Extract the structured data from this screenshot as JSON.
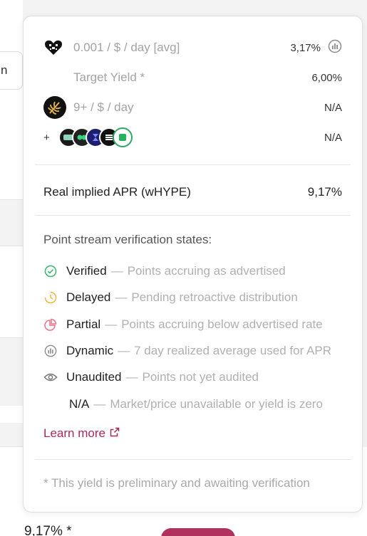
{
  "background": {
    "left_button_text": "n",
    "bottom_value": "9,17% *"
  },
  "tooltip": {
    "rows": [
      {
        "label": "0.001 / $ / day [avg]",
        "value": "3,17%",
        "icon": "hype-logo-icon",
        "status_icon": "dynamic-chart-icon"
      },
      {
        "label": "Target Yield *",
        "value": "6,00%"
      },
      {
        "label": "9+ / $ / day",
        "value": "N/A",
        "icon": "gold-leaf-logo-icon"
      },
      {
        "prefix": "+",
        "value": "N/A",
        "icons": [
          "coin-icon-1",
          "coin-icon-2",
          "coin-icon-3",
          "coin-icon-4",
          "coin-icon-5"
        ]
      }
    ],
    "apr": {
      "label": "Real implied APR (wHYPE)",
      "value": "9,17%"
    },
    "states_title": "Point stream verification states:",
    "states": [
      {
        "name": "Verified",
        "desc": "Points accruing as advertised",
        "icon": "check-circle-icon",
        "color": "#3bb56b"
      },
      {
        "name": "Delayed",
        "desc": "Pending retroactive distribution",
        "icon": "clock-icon",
        "color": "#f0b73c"
      },
      {
        "name": "Partial",
        "desc": "Points accruing below advertised rate",
        "icon": "pie-partial-icon",
        "color": "#e8748a"
      },
      {
        "name": "Dynamic",
        "desc": "7 day realized average used for APR",
        "icon": "bar-chart-circle-icon",
        "color": "#8a8a8a"
      },
      {
        "name": "Unaudited",
        "desc": "Points not yet audited",
        "icon": "eye-icon",
        "color": "#777777"
      },
      {
        "name": "N/A",
        "desc": "Market/price unavailable or yield is zero"
      }
    ],
    "learn_more": "Learn more",
    "footnote": "* This yield is preliminary and awaiting verification"
  },
  "colors": {
    "accent": "#a7285a",
    "muted": "#a3a3a3"
  }
}
